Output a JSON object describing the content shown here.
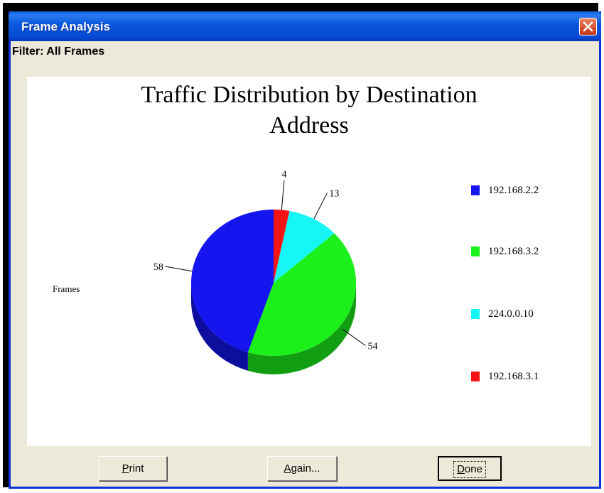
{
  "window": {
    "title": "Frame Analysis",
    "filter_label": "Filter: All Frames"
  },
  "chart_data": {
    "type": "pie",
    "title": "Traffic Distribution by Destination Address",
    "title_lines": [
      "Traffic Distribution by Destination",
      "Address"
    ],
    "ylabel": "Frames",
    "series": [
      {
        "name": "192.168.2.2",
        "value": 58,
        "color": "#1515f0"
      },
      {
        "name": "192.168.3.2",
        "value": 54,
        "color": "#1bf01b"
      },
      {
        "name": "224.0.0.10",
        "value": 13,
        "color": "#17f6f6"
      },
      {
        "name": "192.168.3.1",
        "value": 4,
        "color": "#f31515"
      }
    ],
    "legend_position": "right",
    "style": "3d"
  },
  "buttons": {
    "print": {
      "label": "Print",
      "mnemonic": "P"
    },
    "again": {
      "label": "Again...",
      "mnemonic": "A"
    },
    "done": {
      "label": "Done",
      "mnemonic": "D"
    }
  },
  "icons": {
    "close": "close-icon"
  },
  "colors": {
    "titlebar": "#0a5ddf",
    "close_button": "#d74e2d",
    "window_bg": "#ece9d8"
  }
}
